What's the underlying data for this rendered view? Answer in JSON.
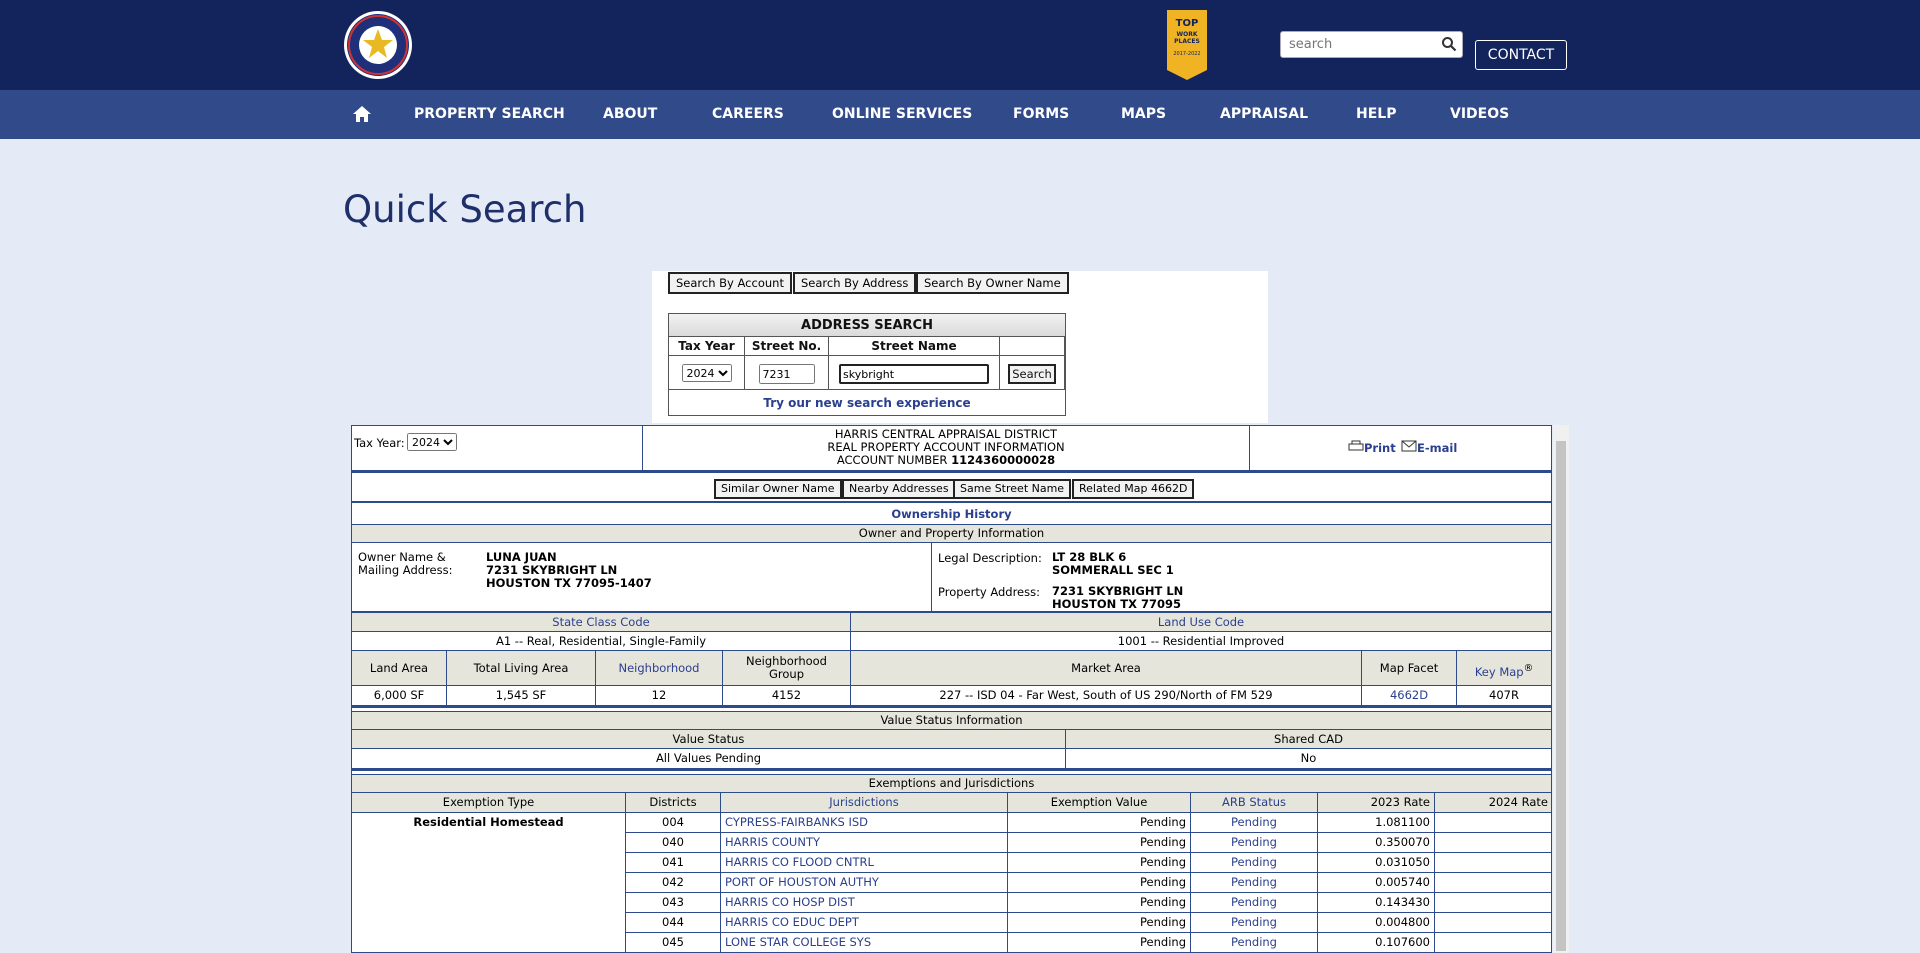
{
  "header": {
    "search_placeholder": "search",
    "contact_label": "CONTACT",
    "badge_text": "TOP WORK PLACES 2017-2022"
  },
  "nav": {
    "items": [
      "PROPERTY SEARCH",
      "ABOUT",
      "CAREERS",
      "ONLINE SERVICES",
      "FORMS",
      "MAPS",
      "APPRAISAL",
      "HELP",
      "VIDEOS"
    ]
  },
  "page_title": "Quick Search",
  "search_panel": {
    "buttons": [
      "Search By Account",
      "Search By Address",
      "Search By Owner Name"
    ],
    "address_search": {
      "heading": "ADDRESS SEARCH",
      "col_tax_year": "Tax Year",
      "col_street_no": "Street No.",
      "col_street_name": "Street Name",
      "tax_year_value": "2024",
      "street_no_value": "7231",
      "street_name_value": "skybright",
      "search_button": "Search",
      "new_search_link": "Try our new search experience"
    }
  },
  "record": {
    "tax_year_label": "Tax Year:",
    "tax_year_value": "2024",
    "header_line1": "HARRIS CENTRAL APPRAISAL DISTRICT",
    "header_line2": "REAL PROPERTY ACCOUNT INFORMATION",
    "account_prefix": "ACCOUNT NUMBER",
    "account_number": "1124360000028",
    "print_label": "Print",
    "email_label": "E-mail",
    "tool_buttons": [
      "Similar Owner Name",
      "Nearby Addresses",
      "Same Street Name",
      "Related Map 4662D"
    ],
    "ownership_history": "Ownership History",
    "owner_section_title": "Owner and Property Information",
    "owner_label_1": "Owner Name &",
    "owner_label_2": "Mailing Address:",
    "owner_name": "LUNA JUAN",
    "owner_addr1": "7231 SKYBRIGHT LN",
    "owner_addr2": "HOUSTON TX 77095-1407",
    "legal_label": "Legal Description:",
    "legal_1": "LT 28 BLK 6",
    "legal_2": "SOMMERALL SEC 1",
    "prop_addr_label": "Property Address:",
    "prop_addr_1": "7231 SKYBRIGHT LN",
    "prop_addr_2": "HOUSTON TX 77095",
    "state_class_label": "State Class Code",
    "state_class_value": "A1 -- Real, Residential, Single-Family",
    "land_use_label": "Land Use Code",
    "land_use_value": "1001 -- Residential Improved",
    "col_land_area": "Land Area",
    "col_total_living": "Total Living Area",
    "col_neighborhood": "Neighborhood",
    "col_nbhd_group_1": "Neighborhood",
    "col_nbhd_group_2": "Group",
    "col_market_area": "Market Area",
    "col_map_facet": "Map Facet",
    "col_key_map": "Key Map",
    "key_map_sup": "®",
    "land_area": "6,000 SF",
    "total_living": "1,545 SF",
    "neighborhood": "12",
    "nbhd_group": "4152",
    "market_area": "227 -- ISD 04 - Far West, South of US 290/North of FM 529",
    "map_facet": "4662D",
    "key_map": "407R",
    "value_status_section": "Value Status Information",
    "col_value_status": "Value Status",
    "col_shared_cad": "Shared CAD",
    "value_status": "All Values Pending",
    "shared_cad": "No",
    "exemptions_section": "Exemptions and Jurisdictions",
    "ex_headers": [
      "Exemption Type",
      "Districts",
      "Jurisdictions",
      "Exemption Value",
      "ARB Status",
      "2023 Rate",
      "2024 Rate"
    ],
    "exemption_type": "Residential Homestead",
    "ex_rows": [
      {
        "district": "004",
        "jurisdiction": "CYPRESS-FAIRBANKS ISD",
        "value": "Pending",
        "arb": "Pending",
        "rate2023": "1.081100",
        "rate2024": ""
      },
      {
        "district": "040",
        "jurisdiction": "HARRIS COUNTY",
        "value": "Pending",
        "arb": "Pending",
        "rate2023": "0.350070",
        "rate2024": ""
      },
      {
        "district": "041",
        "jurisdiction": "HARRIS CO FLOOD CNTRL",
        "value": "Pending",
        "arb": "Pending",
        "rate2023": "0.031050",
        "rate2024": ""
      },
      {
        "district": "042",
        "jurisdiction": "PORT OF HOUSTON AUTHY",
        "value": "Pending",
        "arb": "Pending",
        "rate2023": "0.005740",
        "rate2024": ""
      },
      {
        "district": "043",
        "jurisdiction": "HARRIS CO HOSP DIST",
        "value": "Pending",
        "arb": "Pending",
        "rate2023": "0.143430",
        "rate2024": ""
      },
      {
        "district": "044",
        "jurisdiction": "HARRIS CO EDUC DEPT",
        "value": "Pending",
        "arb": "Pending",
        "rate2023": "0.004800",
        "rate2024": ""
      },
      {
        "district": "045",
        "jurisdiction": "LONE STAR COLLEGE SYS",
        "value": "Pending",
        "arb": "Pending",
        "rate2023": "0.107600",
        "rate2024": ""
      }
    ]
  }
}
